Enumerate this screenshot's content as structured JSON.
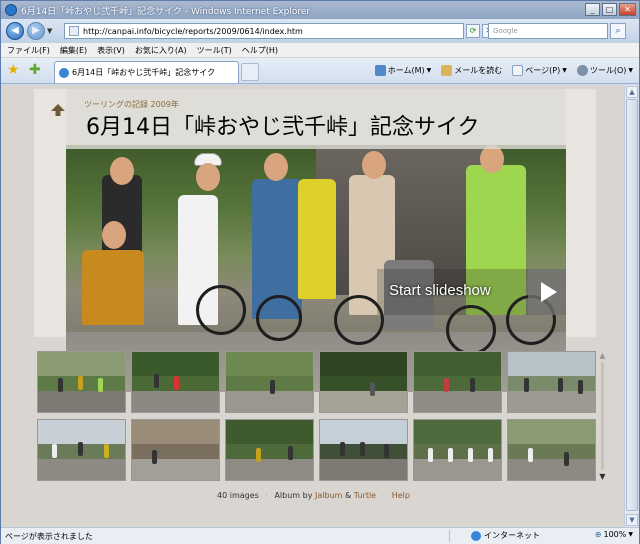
{
  "window": {
    "title": "6月14日「峠おやじ弐千峠」記念サイク - Windows Internet Explorer"
  },
  "address": {
    "url": "http://canpai.info/bicycle/reports/2009/0614/index.htm",
    "search_placeholder": "Google"
  },
  "menu": {
    "items": [
      "ファイル(F)",
      "編集(E)",
      "表示(V)",
      "お気に入り(A)",
      "ツール(T)",
      "ヘルプ(H)"
    ]
  },
  "tab": {
    "label": "6月14日「峠おやじ弐千峠」記念サイク"
  },
  "commands": {
    "home": "ホーム(M)",
    "mail": "メールを読む",
    "page": "ページ(P)",
    "tools": "ツール(O)"
  },
  "album": {
    "subtitle": "ツーリングの記録 2009年",
    "title": "6月14日「峠おやじ弐千峠」記念サイク",
    "slideshow": "Start slideshow",
    "image_count": "40 images",
    "album_by": "Album by",
    "jalbum": "Jalbum",
    "amp": "&",
    "turtle": "Turtle",
    "help": "Help"
  },
  "status": {
    "text": "ページが表示されました",
    "zone": "インターネット",
    "zoom": "100%"
  },
  "colors": {
    "link": "#8a5a2a",
    "title_overlay": "#dcdad6"
  }
}
